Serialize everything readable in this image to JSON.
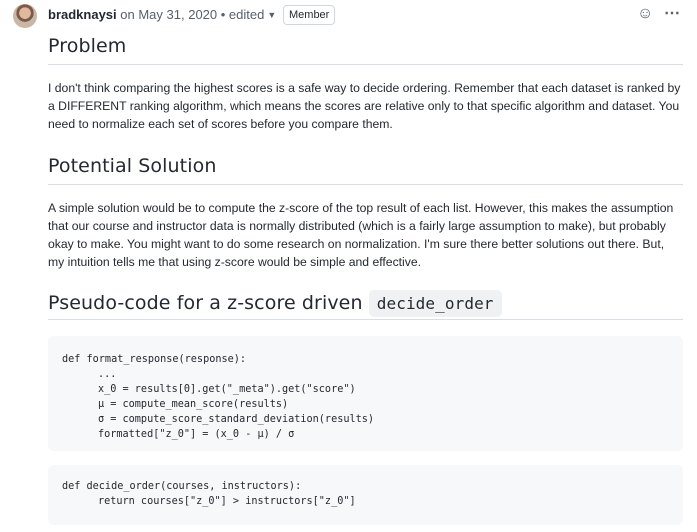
{
  "comment": {
    "author": "bradknaysi",
    "date_text": "on May 31, 2020",
    "edited_text": "• edited",
    "badge": "Member",
    "icons": {
      "emoji": "smiley-icon",
      "menu": "kebab-menu-icon",
      "edited_dropdown": "caret-down-icon"
    }
  },
  "sections": {
    "problem": {
      "heading": "Problem",
      "paragraph": "I don't think comparing the highest scores is a safe way to decide ordering. Remember that each dataset is ranked by a DIFFERENT ranking algorithm, which means the scores are relative only to that specific algorithm and dataset. You need to normalize each set of scores before you compare them."
    },
    "solution": {
      "heading": "Potential Solution",
      "paragraph": "A simple solution would be to compute the z-score of the top result of each list. However, this makes the assumption that our course and instructor data is normally distributed (which is a fairly large assumption to make), but probably okay to make. You might want to do some research on normalization. I'm sure there better solutions out there. But, my intuition tells me that using z-score would be simple and effective."
    },
    "pseudo": {
      "heading_text": "Pseudo-code for a z-score driven",
      "heading_code": "decide_order"
    }
  },
  "code_blocks": {
    "block1": {
      "lines": [
        "def format_response(response):",
        "...",
        "x_0 = results[0].get(\"_meta\").get(\"score\")",
        "μ = compute_mean_score(results)",
        "σ = compute_score_standard_deviation(results)",
        "formatted[\"z_0\"] = (x_0 - μ) / σ"
      ]
    },
    "block2": {
      "lines": [
        "def decide_order(courses, instructors):",
        "return courses[\"z_0\"] > instructors[\"z_0\"]"
      ]
    }
  }
}
